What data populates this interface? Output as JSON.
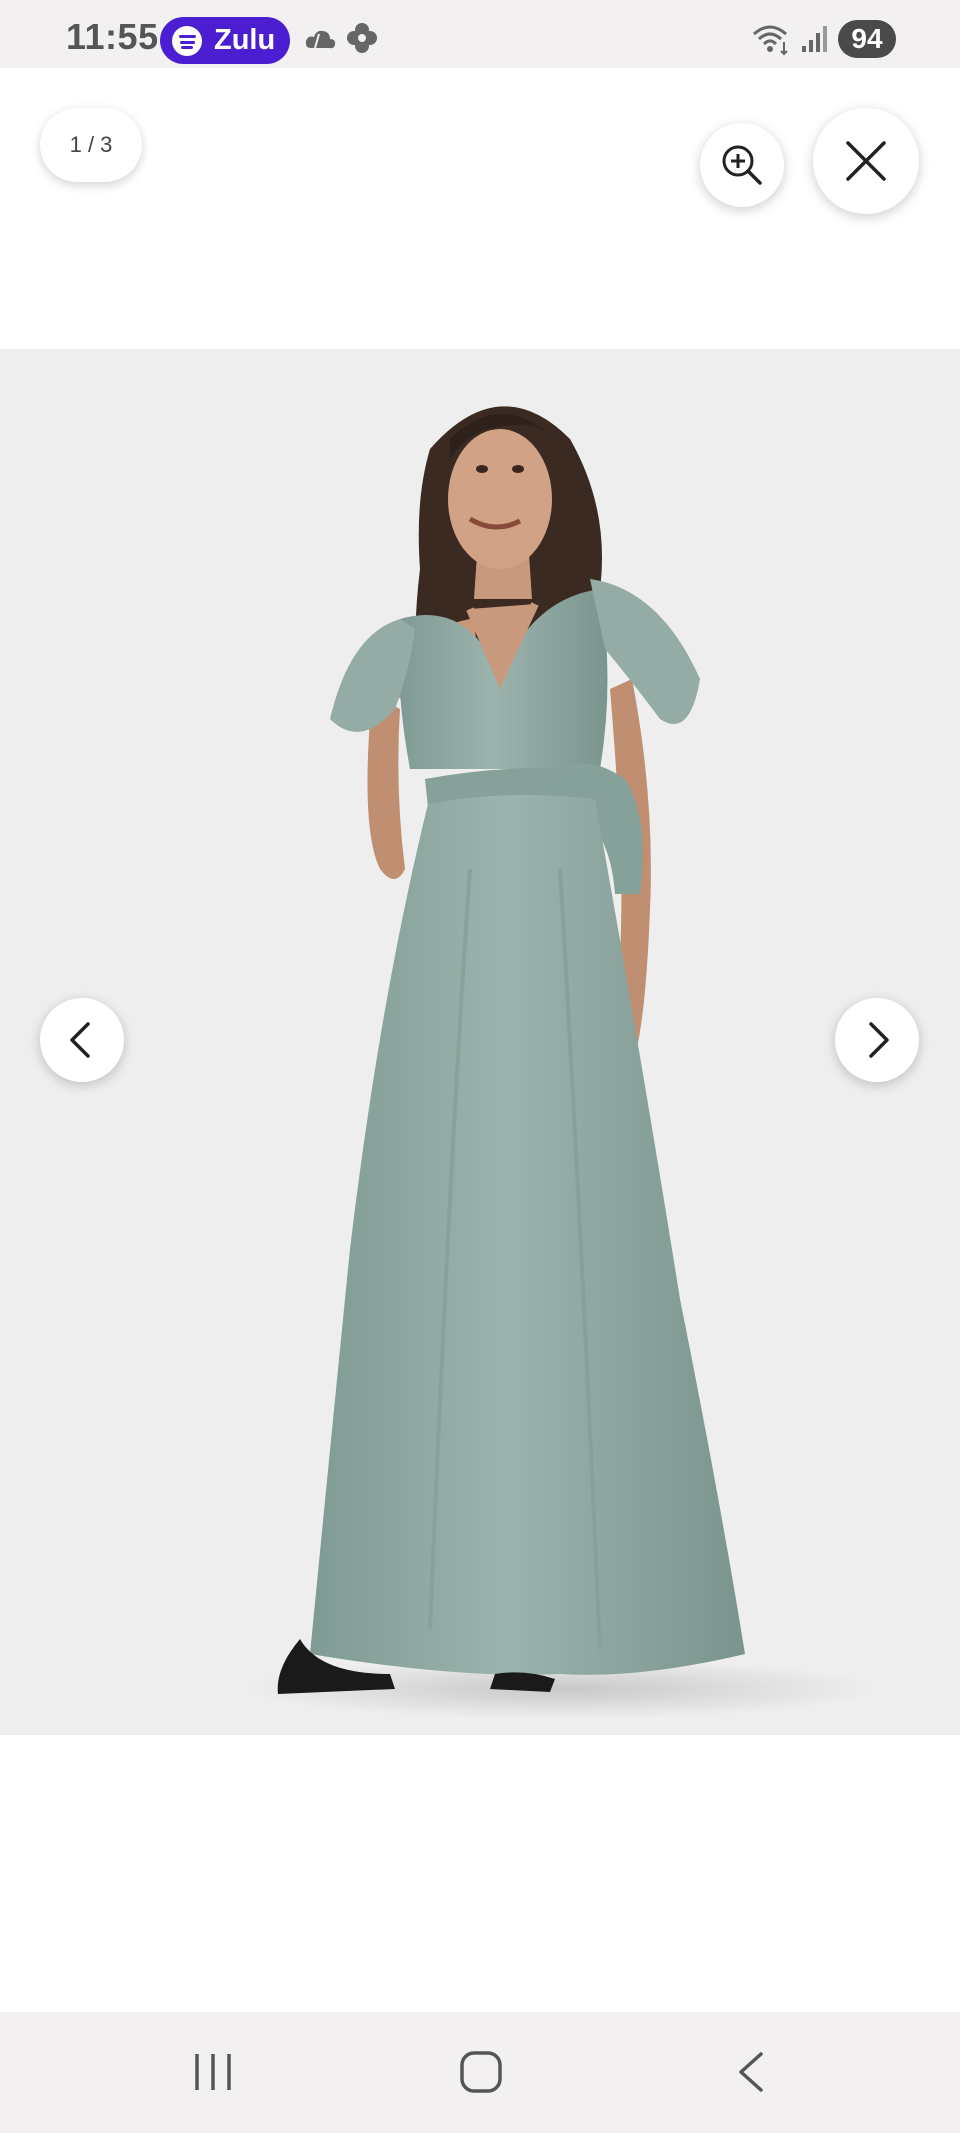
{
  "status_bar": {
    "time": "11:55",
    "media_app_label": "Zulu",
    "battery_level": "94",
    "icons": [
      "spotify-icon",
      "weather-icon",
      "flower-icon",
      "wifi-icon",
      "signal-icon",
      "battery-icon"
    ],
    "spotify_color": "#4b1fd1"
  },
  "viewer": {
    "counter": "1 / 3",
    "image_index": 1,
    "image_total": 3,
    "buttons": [
      "zoom-in",
      "close",
      "previous",
      "next"
    ],
    "dress_color": "#8fa8a2"
  },
  "nav_bar": {
    "buttons": [
      "recent-apps",
      "home",
      "back"
    ]
  }
}
